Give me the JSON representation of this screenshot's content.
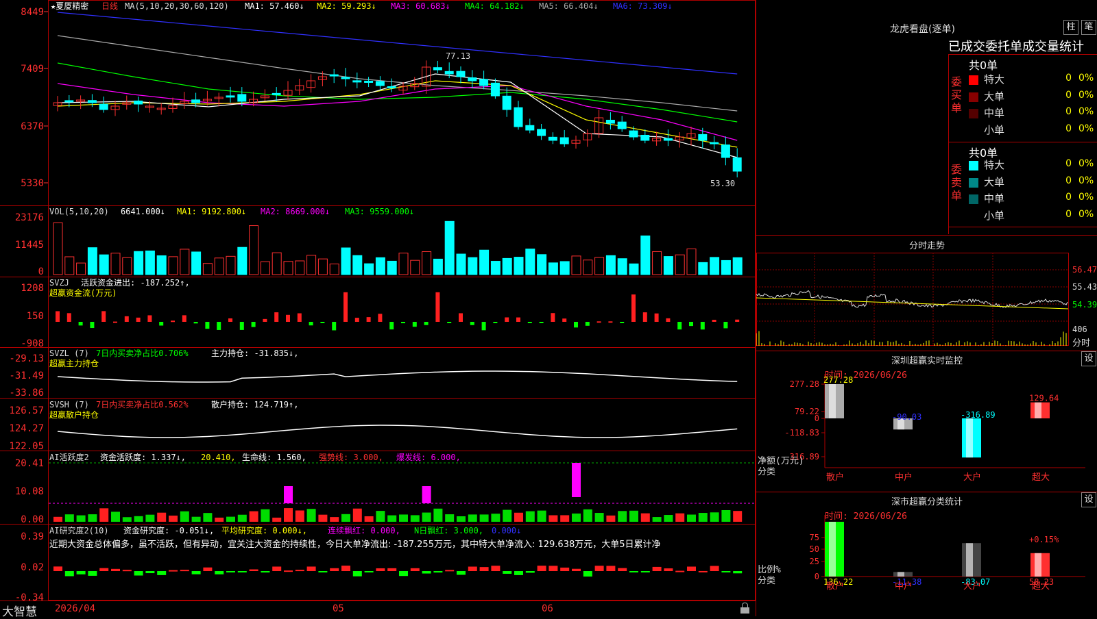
{
  "app": {
    "brand": "大智慧"
  },
  "main_chart": {
    "title": "★夏厦精密",
    "period": "日线",
    "ma_label": "MA(5,10,20,30,60,120)",
    "ma1": "MA1: 57.460↓",
    "ma2": "MA2: 59.293↓",
    "ma3": "MA3: 60.683↓",
    "ma4": "MA4: 64.182↓",
    "ma5": "MA5: 66.404↓",
    "ma6": "MA6: 73.309↓",
    "y_ticks": [
      "8449",
      "7409",
      "6370",
      "5330"
    ],
    "high_label": "77.13",
    "low_label": "53.30",
    "colors": {
      "up": "#ff3030",
      "down": "#00ffff",
      "ma1": "#ffffff",
      "ma2": "#ffff00",
      "ma3": "#ff00ff",
      "ma4": "#00ff00",
      "ma5": "#aaaaaa",
      "ma6": "#3030ff"
    }
  },
  "vol_panel": {
    "label": "VOL(5,10,20)",
    "value": "6641.000↓",
    "ma1": "MA1: 9192.800↓",
    "ma2": "MA2: 8669.000↓",
    "ma3": "MA3: 9559.000↓",
    "y_ticks": [
      "23176",
      "11445",
      "0"
    ]
  },
  "svzj_panel": {
    "label": "SVZJ",
    "desc": "活跃资金进出: -187.252↑,",
    "sub": "超赢资金流(万元)",
    "y_ticks": [
      "1208",
      "150",
      "-908"
    ]
  },
  "svzl_panel": {
    "label": "SVZL (7)",
    "desc1": "7日内买卖净占比0.706%",
    "desc2": "主力持仓: -31.835↓,",
    "sub": "超赢主力持仓",
    "y_ticks": [
      "-29.13",
      "-31.49",
      "-33.86"
    ]
  },
  "svsh_panel": {
    "label": "SVSH (7)",
    "desc1": "7日内买卖净占比0.562%",
    "desc2": "散户持仓: 124.719↑,",
    "sub": "超赢散户持仓",
    "y_ticks": [
      "126.57",
      "124.27",
      "122.05"
    ]
  },
  "ai_active_panel": {
    "label": "AI活跃度2",
    "t1": "资金活跃度: 1.337↓,",
    "t2": "20.410,",
    "t3": "生命线: 1.560,",
    "t4": "强势线: 3.000,",
    "t5": "爆发线: 6.000,",
    "y_ticks": [
      "20.41",
      "10.08",
      "0.00"
    ]
  },
  "ai_research_panel": {
    "label": "AI研究度2(10)",
    "t1": "资金研究度: -0.051↓,",
    "t2": "平均研究度: 0.000↓,",
    "t3": "连续飘红: 0.000,",
    "t4": "N日飘红: 3.000,",
    "t5": "0.000↓",
    "comment": "近期大资金总体偏多，虽不活跃，但有异动，宜关注大资金的持续性，今日大单净流出: -187.255万元，其中特大单净流入: 129.638万元，大单5日累计净",
    "y_ticks": [
      "0.39",
      "0.02",
      "-0.34"
    ]
  },
  "x_axis": {
    "labels": [
      "2026/04",
      "05",
      "06"
    ]
  },
  "sidebar": {
    "longhu": {
      "title": "龙虎看盘(逐单)",
      "btn_zhu": "柱",
      "btn_bi": "笔",
      "heading": "已成交委托单成交量统计",
      "buy_label": "委买单",
      "sell_label": "委卖单",
      "buy_total": "共0单",
      "sell_total": "共0单",
      "buy_rows": [
        {
          "label": "特大",
          "vol": "0",
          "pct": "0%",
          "color": "#ff0000"
        },
        {
          "label": "大单",
          "vol": "0",
          "pct": "0%",
          "color": "#880000"
        },
        {
          "label": "中单",
          "vol": "0",
          "pct": "0%",
          "color": "#550000"
        },
        {
          "label": "小单",
          "vol": "0",
          "pct": "0%",
          "color": ""
        }
      ],
      "sell_rows": [
        {
          "label": "特大",
          "vol": "0",
          "pct": "0%",
          "color": "#00ffff"
        },
        {
          "label": "大单",
          "vol": "0",
          "pct": "0%",
          "color": "#008888"
        },
        {
          "label": "中单",
          "vol": "0",
          "pct": "0%",
          "color": "#006666"
        },
        {
          "label": "小单",
          "vol": "0",
          "pct": "0%",
          "color": ""
        }
      ]
    },
    "intraday": {
      "title": "分时走势",
      "y_ticks": [
        "56.47",
        "55.43",
        "54.39"
      ],
      "vol_tick": "406",
      "vol_label": "分时"
    },
    "monitor": {
      "title": "深圳超赢实时监控",
      "btn": "设",
      "time": "时间: 2026/06/26",
      "y_ticks": [
        "277.28",
        "79.22",
        "0",
        "-118.83",
        "-316.89"
      ],
      "axis_label1": "净额(万元)",
      "axis_label2": "分类",
      "bars": [
        {
          "name": "散户",
          "value": 277.28,
          "label": "277.28"
        },
        {
          "name": "中户",
          "value": -90.03,
          "label": "-90.03"
        },
        {
          "name": "大户",
          "value": -316.89,
          "label": "-316.89"
        },
        {
          "name": "超大",
          "value": 129.64,
          "label": "129.64"
        }
      ]
    },
    "classify": {
      "title": "深市超赢分类统计",
      "btn": "设",
      "time": "时间: 2026/06/26",
      "y_ticks": [
        "75",
        "50",
        "25",
        "0"
      ],
      "axis_label1": "比例%",
      "axis_label2": "分类",
      "pct_note": "+0.15%",
      "bars": [
        {
          "name": "散户",
          "value": 136.22,
          "label": "136.22"
        },
        {
          "name": "中户",
          "value": -11.38,
          "label": "-11.38"
        },
        {
          "name": "大户",
          "value": -83.07,
          "label": "-83.07"
        },
        {
          "name": "超大",
          "value": 58.23,
          "label": "58.23"
        }
      ]
    }
  }
}
